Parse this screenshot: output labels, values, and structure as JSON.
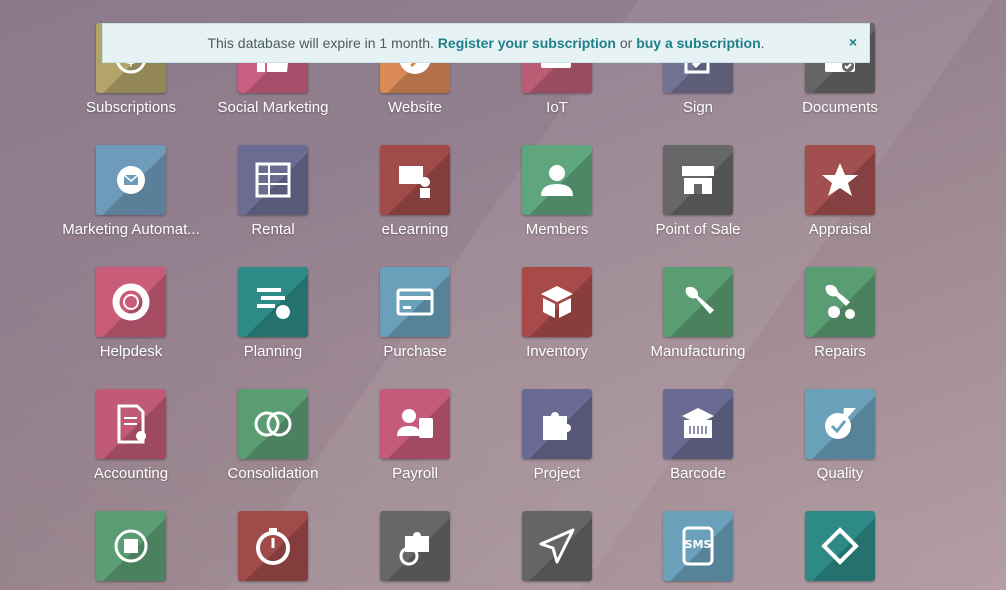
{
  "banner": {
    "text_before": "This database will expire in 1 month.",
    "register_link": "Register your subscription",
    "text_middle": "or",
    "buy_link": "buy a subscription",
    "text_after": ".",
    "close_label": "×"
  },
  "apps": [
    {
      "label": "Subscriptions",
      "color": "#b3a56a",
      "icon": "subscriptions-icon"
    },
    {
      "label": "Social Marketing",
      "color": "#c96082",
      "icon": "thumbs-up-icon"
    },
    {
      "label": "Website",
      "color": "#d98a57",
      "icon": "globe-icon"
    },
    {
      "label": "IoT",
      "color": "#bb5c75",
      "icon": "iot-icon"
    },
    {
      "label": "Sign",
      "color": "#727293",
      "icon": "sign-icon"
    },
    {
      "label": "Documents",
      "color": "#656565",
      "icon": "documents-icon"
    },
    {
      "label": "Marketing Automat...",
      "color": "#6f9bbb",
      "icon": "gear-mail-icon"
    },
    {
      "label": "Rental",
      "color": "#6c6c92",
      "icon": "rental-icon"
    },
    {
      "label": "eLearning",
      "color": "#a04a4a",
      "icon": "elearning-icon"
    },
    {
      "label": "Members",
      "color": "#5fa57d",
      "icon": "member-icon"
    },
    {
      "label": "Point of Sale",
      "color": "#676767",
      "icon": "store-icon"
    },
    {
      "label": "Appraisal",
      "color": "#a24f4f",
      "icon": "star-icon"
    },
    {
      "label": "Helpdesk",
      "color": "#c95c78",
      "icon": "lifebuoy-icon"
    },
    {
      "label": "Planning",
      "color": "#2d8a86",
      "icon": "planning-icon"
    },
    {
      "label": "Purchase",
      "color": "#6aa0ba",
      "icon": "credit-card-icon"
    },
    {
      "label": "Inventory",
      "color": "#a84a4a",
      "icon": "box-icon"
    },
    {
      "label": "Manufacturing",
      "color": "#5b9d73",
      "icon": "wrench-icon"
    },
    {
      "label": "Repairs",
      "color": "#5b9d73",
      "icon": "wrench-gear-icon"
    },
    {
      "label": "Accounting",
      "color": "#c05a76",
      "icon": "invoice-icon"
    },
    {
      "label": "Consolidation",
      "color": "#5b9d73",
      "icon": "circles-icon"
    },
    {
      "label": "Payroll",
      "color": "#c55a7a",
      "icon": "payroll-icon"
    },
    {
      "label": "Project",
      "color": "#6a6a93",
      "icon": "puzzle-icon"
    },
    {
      "label": "Barcode",
      "color": "#6a6a93",
      "icon": "barcode-box-icon"
    },
    {
      "label": "Quality",
      "color": "#6aa0ba",
      "icon": "quality-icon"
    },
    {
      "label": "",
      "color": "#5b9d73",
      "icon": "cycle-box-icon"
    },
    {
      "label": "",
      "color": "#a04a4a",
      "icon": "stopwatch-icon"
    },
    {
      "label": "",
      "color": "#676767",
      "icon": "puzzle-clock-icon"
    },
    {
      "label": "",
      "color": "#656565",
      "icon": "paper-plane-icon"
    },
    {
      "label": "SMS",
      "color": "#6aa0ba",
      "icon": "sms-icon"
    },
    {
      "label": "",
      "color": "#2d8a86",
      "icon": "ticket-icon"
    }
  ]
}
